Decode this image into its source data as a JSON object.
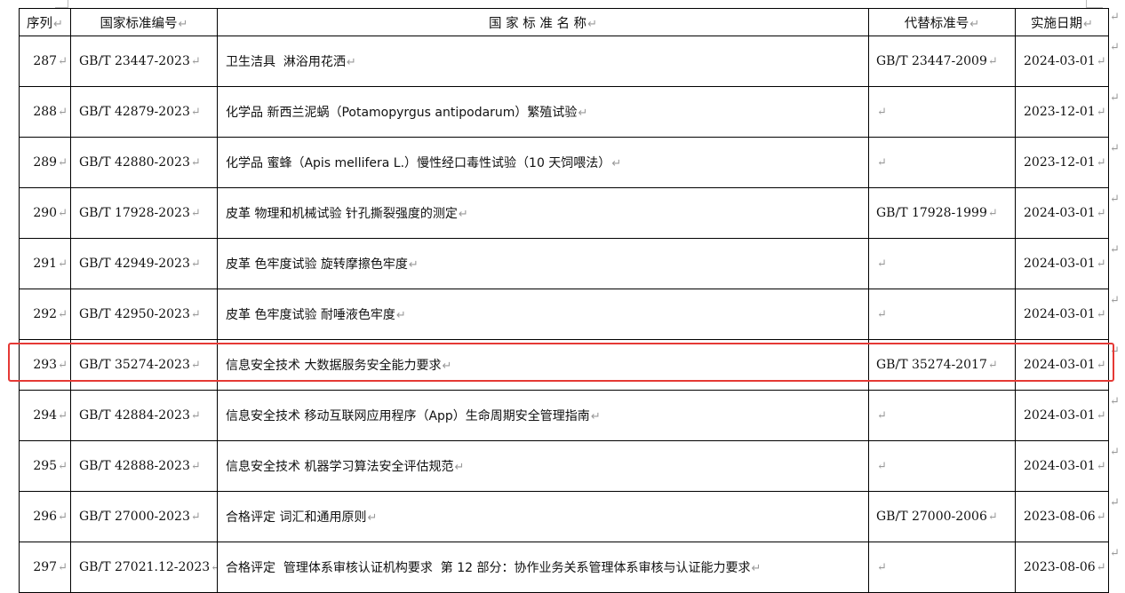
{
  "table": {
    "headers": {
      "seq": "序列",
      "code": "国家标准编号",
      "name": "国 家 标 准 名 称",
      "replaced": "代替标准号",
      "date": "实施日期"
    },
    "paragraph_mark": "↵",
    "rows": [
      {
        "seq": "287",
        "code": "GB/T 23447-2023",
        "name": "卫生洁具  淋浴用花洒",
        "replaced": "GB/T 23447-2009",
        "date": "2024-03-01"
      },
      {
        "seq": "288",
        "code": "GB/T 42879-2023",
        "name": "化学品 新西兰泥蜗（Potamopyrgus antipodarum）繁殖试验",
        "replaced": "",
        "date": "2023-12-01"
      },
      {
        "seq": "289",
        "code": "GB/T 42880-2023",
        "name": "化学品 蜜蜂（Apis mellifera L.）慢性经口毒性试验（10 天饲喂法）",
        "replaced": "",
        "date": "2023-12-01"
      },
      {
        "seq": "290",
        "code": "GB/T 17928-2023",
        "name": "皮革 物理和机械试验 针孔撕裂强度的测定",
        "replaced": "GB/T 17928-1999",
        "date": "2024-03-01"
      },
      {
        "seq": "291",
        "code": "GB/T 42949-2023",
        "name": "皮革 色牢度试验 旋转摩擦色牢度",
        "replaced": "",
        "date": "2024-03-01"
      },
      {
        "seq": "292",
        "code": "GB/T 42950-2023",
        "name": "皮革 色牢度试验 耐唾液色牢度",
        "replaced": "",
        "date": "2024-03-01"
      },
      {
        "seq": "293",
        "code": "GB/T 35274-2023",
        "name": "信息安全技术 大数据服务安全能力要求",
        "replaced": "GB/T 35274-2017",
        "date": "2024-03-01"
      },
      {
        "seq": "294",
        "code": "GB/T 42884-2023",
        "name": "信息安全技术 移动互联网应用程序（App）生命周期安全管理指南",
        "replaced": "",
        "date": "2024-03-01"
      },
      {
        "seq": "295",
        "code": "GB/T 42888-2023",
        "name": "信息安全技术 机器学习算法安全评估规范",
        "replaced": "",
        "date": "2024-03-01"
      },
      {
        "seq": "296",
        "code": "GB/T 27000-2023",
        "name": "合格评定 词汇和通用原则",
        "replaced": "GB/T 27000-2006",
        "date": "2023-08-06"
      },
      {
        "seq": "297",
        "code": "GB/T 27021.12-2023",
        "name": "合格评定  管理体系审核认证机构要求  第 12 部分：协作业务关系管理体系审核与认证能力要求",
        "replaced": "",
        "date": "2023-08-06"
      }
    ],
    "highlighted_seq": "293",
    "highlight_color": "#e53935"
  }
}
